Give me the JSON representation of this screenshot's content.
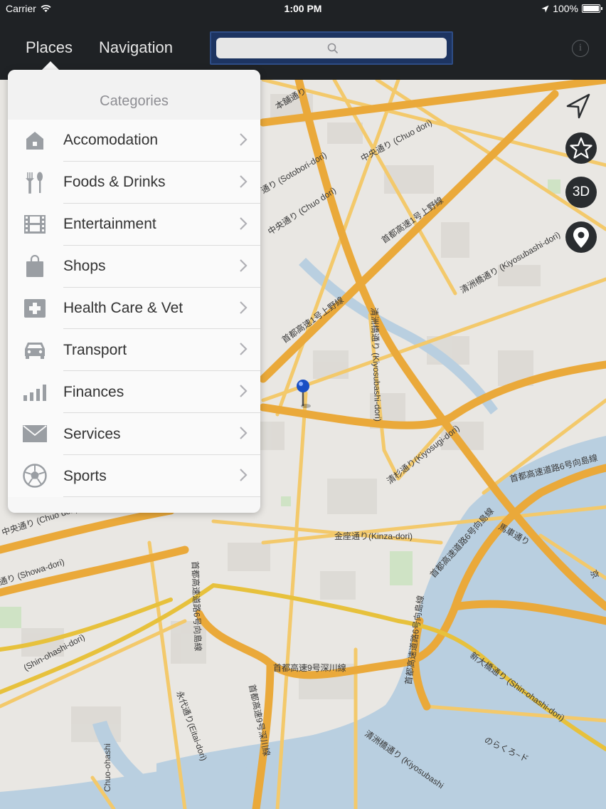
{
  "status_bar": {
    "carrier": "Carrier",
    "time": "1:00 PM",
    "battery": "100%"
  },
  "nav": {
    "tabs": [
      "Places",
      "Navigation"
    ],
    "search_placeholder": "",
    "info_icon": "info-icon"
  },
  "popover": {
    "title": "Categories",
    "items": [
      {
        "label": "Accomodation",
        "icon": "house-icon"
      },
      {
        "label": "Foods & Drinks",
        "icon": "fork-spoon-icon"
      },
      {
        "label": "Entertainment",
        "icon": "film-icon"
      },
      {
        "label": "Shops",
        "icon": "shopping-bag-icon"
      },
      {
        "label": "Health Care & Vet",
        "icon": "medical-cross-icon"
      },
      {
        "label": "Transport",
        "icon": "car-icon"
      },
      {
        "label": "Finances",
        "icon": "bar-chart-icon"
      },
      {
        "label": "Services",
        "icon": "envelope-icon"
      },
      {
        "label": "Sports",
        "icon": "soccer-ball-icon"
      }
    ]
  },
  "map_controls": {
    "mode_3d": "3D",
    "icons": [
      "navigation-arrow-icon",
      "star-icon",
      "location-pin-icon"
    ]
  },
  "map_labels": {
    "chuo_dori": "中央通り (Chuo dori)",
    "kinza_dori": "金座通り(Kinza-dori)",
    "kiyosubashi_dori": "清洲橋通り (Kiyosubashi-dori)",
    "kiyosugi_dori": "清杉通り(Kiyosugi-dori)",
    "sotobori_dori": "通り (Sotobori-dori)",
    "showa_dori": "通り (Showa-dori)",
    "shin_ohashi_dori": "(Shin-ohashi-dori)",
    "shin_ohashi_dori_2": "新大橋通り (Shin-ohashi-dori)",
    "expressway_9": "首都高速9号深川線",
    "expressway_6": "首都高速道路6号向島線",
    "expressway_1": "首都高速1号上野線",
    "eitai_dori": "永代通り(Eitai-dori)",
    "kiyosubashi_dori_2": "清洲橋通り (Kiyosubashi",
    "chuo_ohashi": "Chuo-ohashi",
    "horiwa_dori": "昭和通り",
    "honkai_dori": "本舗通り",
    "baba_dori": "馬車通り",
    "norakuro": "のらくろ~ド",
    "kyobashi": "京"
  },
  "colors": {
    "navbar_bg": "#1f2225",
    "search_border": "#2e4d86",
    "road_major": "#eaa93a",
    "road_minor": "#f3c96b",
    "water": "#b9cfe0",
    "park": "#cfe3c5"
  }
}
